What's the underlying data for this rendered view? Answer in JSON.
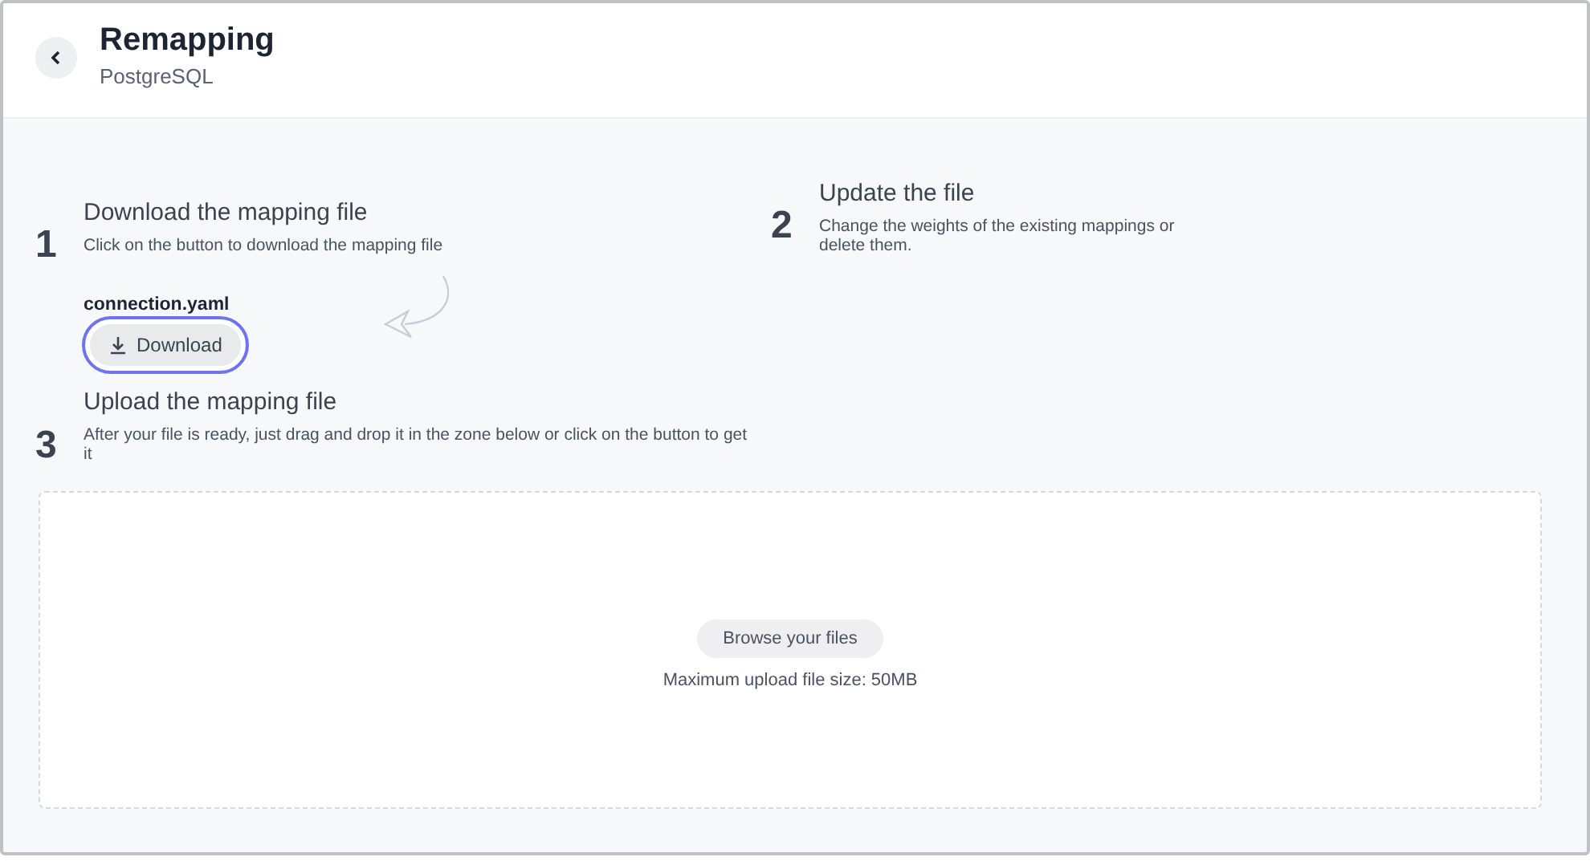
{
  "header": {
    "title": "Remapping",
    "subtitle": "PostgreSQL"
  },
  "steps": [
    {
      "number": "1",
      "title": "Download the mapping file",
      "description": "Click on the button to download the mapping file",
      "file_name": "connection.yaml",
      "button": {
        "label": "Download",
        "focused": true
      }
    },
    {
      "number": "2",
      "title": "Update the file",
      "description": "Change the weights of the existing mappings or delete them."
    },
    {
      "number": "3",
      "title": "Upload the mapping file",
      "description": "After your file is ready, just drag and drop it in the zone below or click on the button to get it"
    }
  ],
  "dropzone": {
    "button": "Browse your files",
    "note": "Maximum upload file size: 50MB"
  }
}
